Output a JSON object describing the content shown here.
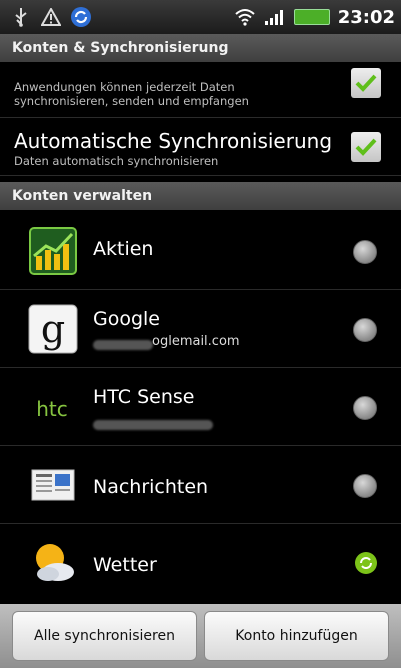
{
  "status_bar": {
    "icons": [
      "usb-icon",
      "warning-icon",
      "sync-app-icon",
      "wifi-icon",
      "signal-icon",
      "battery-icon"
    ],
    "time": "23:02"
  },
  "sections": {
    "accounts_sync": "Konten & Synchronisierung",
    "manage_accounts": "Konten verwalten"
  },
  "settings": {
    "background_data": {
      "subtitle": "Anwendungen können jederzeit Daten synchronisieren, senden und empfangen",
      "checked": true
    },
    "auto_sync": {
      "title": "Automatische Synchronisierung",
      "subtitle": "Daten automatisch synchronisieren",
      "checked": true
    }
  },
  "accounts": [
    {
      "name": "Aktien",
      "sub": "",
      "icon": "stocks-icon",
      "sync": "off"
    },
    {
      "name": "Google",
      "sub": "oglemail.com",
      "icon": "google-icon",
      "sync": "off"
    },
    {
      "name": "HTC Sense",
      "sub": "",
      "icon": "htc-icon",
      "sync": "off"
    },
    {
      "name": "Nachrichten",
      "sub": "",
      "icon": "news-icon",
      "sync": "off"
    },
    {
      "name": "Wetter",
      "sub": "",
      "icon": "weather-icon",
      "sync": "on"
    }
  ],
  "buttons": {
    "sync_all": "Alle synchronisieren",
    "add_account": "Konto hinzufügen"
  },
  "colors": {
    "checkbox_check": "#5fbf1a",
    "sync_active": "#7cc319"
  }
}
